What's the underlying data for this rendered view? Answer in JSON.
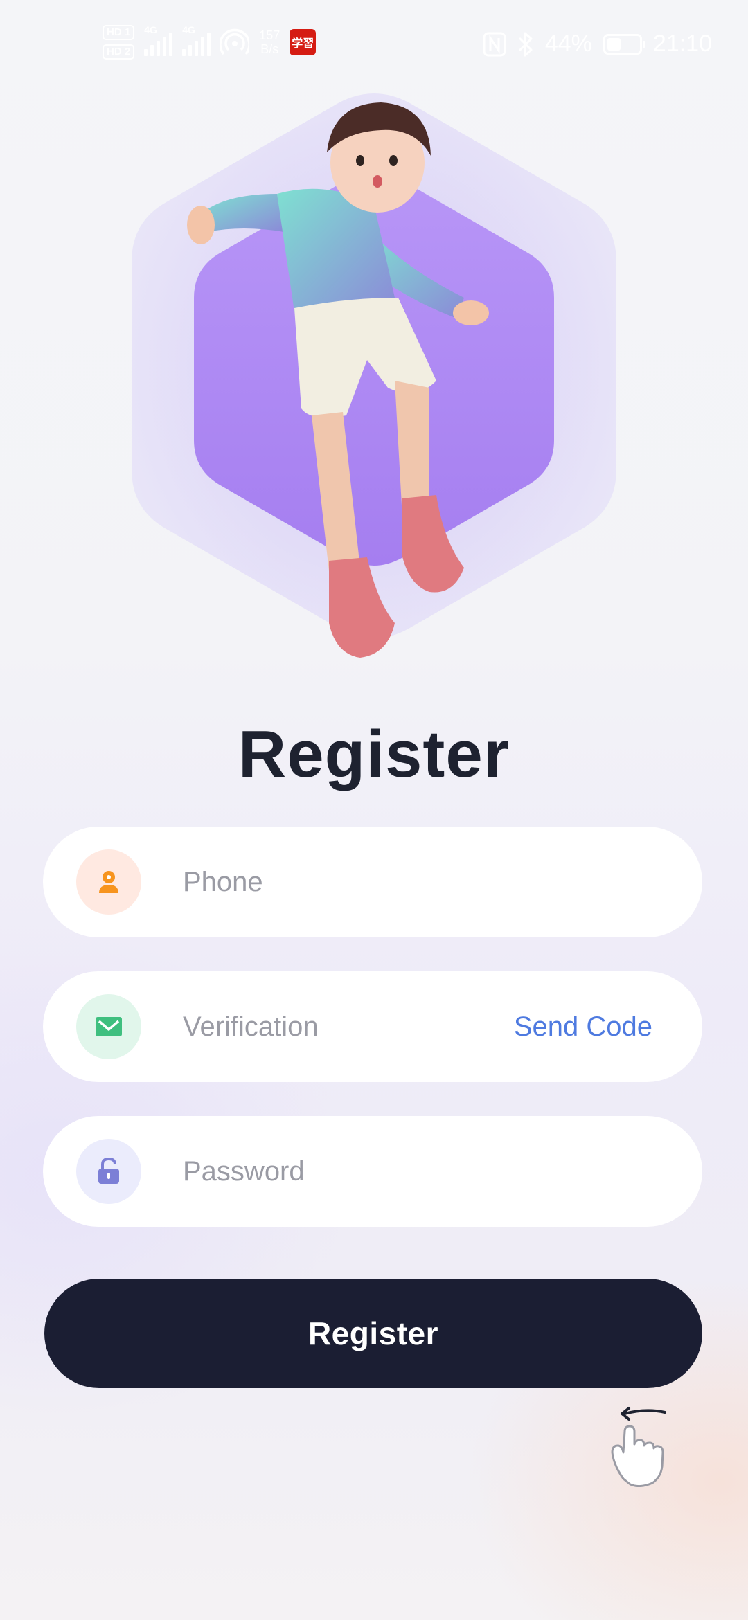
{
  "status_bar": {
    "hd_top": "HD 1",
    "hd_bottom": "HD 2",
    "net_type_1": "4G",
    "net_type_2": "4G",
    "speed_value": "157",
    "speed_unit": "B/s",
    "app_badge_text": "学習",
    "battery_percent": "44%",
    "battery_level": 0.44,
    "time": "21:10"
  },
  "page": {
    "title": "Register"
  },
  "form": {
    "phone": {
      "icon": "user-icon",
      "placeholder": "Phone",
      "icon_color": "#f7941e",
      "icon_bg": "#ffe9e1"
    },
    "verification": {
      "icon": "mail-icon",
      "placeholder": "Verification",
      "send_code_label": "Send Code",
      "icon_color": "#3fbf7f",
      "icon_bg": "#e1f6eb"
    },
    "password": {
      "icon": "lock-icon",
      "placeholder": "Password",
      "icon_color": "#7c7fd6",
      "icon_bg": "#ebecfc"
    },
    "submit_label": "Register"
  },
  "colors": {
    "accent_blue": "#4e7ae0",
    "button_dark": "#1b1e33",
    "title": "#1e2230",
    "hexagon_outer": "#dcd6f7",
    "hexagon_inner": "#b48df3"
  }
}
